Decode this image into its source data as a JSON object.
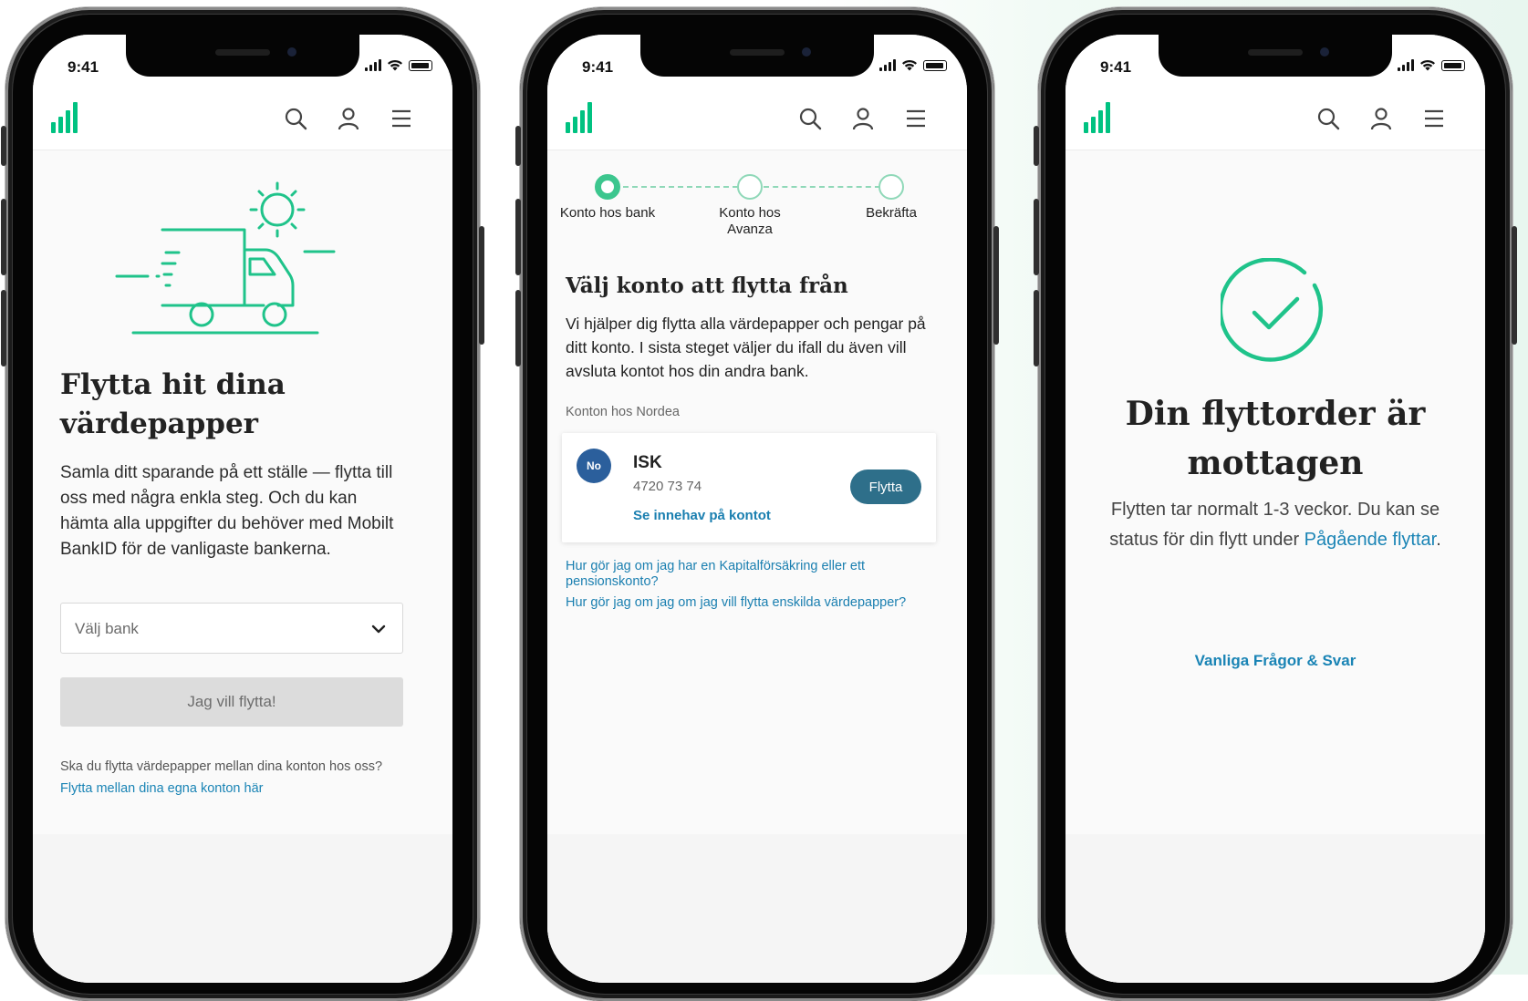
{
  "colors": {
    "accent": "#00c281",
    "link": "#1a84b5",
    "button": "#2e6f8a",
    "bank_avatar": "#2b5f9c"
  },
  "status_bar": {
    "time": "9:41"
  },
  "app_bar": {
    "icons": [
      "bars-logo-icon",
      "search-icon",
      "user-icon",
      "menu-icon"
    ]
  },
  "screen1": {
    "illustration": "delivery-truck-icon",
    "title": "Flytta hit dina värdepapper",
    "body": "Samla ditt sparande på ett ställe — flytta till oss med några enkla steg. Och du kan hämta alla uppgifter du behöver med Mobilt BankID för de vanligaste bankerna.",
    "bank_select": {
      "placeholder": "Välj bank"
    },
    "primary_button": "Jag vill flytta!",
    "footer_question": "Ska du flytta värdepapper mellan dina konton hos oss?",
    "footer_link": "Flytta mellan dina egna konton här"
  },
  "screen2": {
    "steps": [
      {
        "label": "Konto hos bank",
        "active": true
      },
      {
        "label": "Konto hos Avanza",
        "active": false
      },
      {
        "label": "Bekräfta",
        "active": false
      }
    ],
    "title": "Välj konto att flytta från",
    "body": "Vi hjälper dig flytta alla värdepapper och pengar på ditt konto. I sista steget väljer du ifall du även vill avsluta kontot hos din andra bank.",
    "section_label": "Konton hos Nordea",
    "account": {
      "bank_badge": "No",
      "name": "ISK",
      "number": "4720 73 74",
      "link": "Se innehav på kontot",
      "button": "Flytta"
    },
    "help_links": [
      "Hur gör jag om jag har en Kapitalförsäkring eller ett pensionskonto?",
      "Hur gör jag om jag om jag vill flytta enskilda värdepapper?"
    ]
  },
  "screen3": {
    "icon": "check-circle-icon",
    "title": "Din flyttorder är mottagen",
    "body_before_link": "Flytten tar normalt 1-3 veckor. Du kan se status för din flytt under ",
    "body_link": "Pågående flyttar",
    "body_after_link": ".",
    "faq_link": "Vanliga Frågor & Svar"
  }
}
